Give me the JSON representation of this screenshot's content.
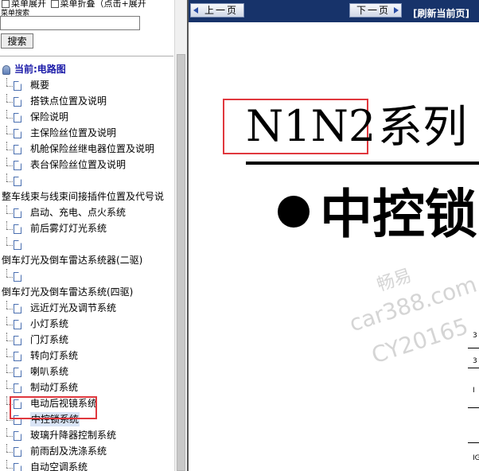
{
  "left_panel": {
    "top_options": [
      "菜单展开",
      "菜单折叠（点击+展开"
    ],
    "search_caption": "菜单搜索",
    "search_value": "",
    "search_button": "搜索",
    "root_label": "当前:电路图",
    "items": [
      "概要",
      "搭铁点位置及说明",
      "保险说明",
      "主保险丝位置及说明",
      "机舱保险丝继电器位置及说明",
      "表台保险丝位置及说明",
      "",
      "整车线束与线束间接插件位置及代号说",
      "启动、充电、点火系统",
      "前后雾灯灯光系统",
      "",
      "倒车灯光及倒车雷达系统器(二驱)",
      "",
      "倒车灯光及倒车雷达系统(四驱)",
      "远近灯光及调节系统",
      "小灯系统",
      "门灯系统",
      "转向灯系统",
      "喇叭系统",
      "制动灯系统",
      "电动后视镜系统",
      "中控锁系统",
      "玻璃升降器控制系统",
      "前雨刮及洗涤系统",
      "自动空调系统"
    ],
    "selected_item": "中控锁系统"
  },
  "toolbar": {
    "prev_label": "上一页",
    "next_label": "下一页",
    "refresh_label": "[刷新当前页]"
  },
  "document": {
    "model": "N1N2",
    "series_text": "系列",
    "subtitle": "中控锁",
    "watermark": [
      "畅易",
      "car388.com",
      "CY20165"
    ],
    "table_fragments": [
      "3",
      "3",
      "I",
      "IG"
    ]
  },
  "colors": {
    "toolbar_bg": "#17336a",
    "root_label": "#1a1aa8",
    "annotation_red": "#e0383e",
    "watermark": "#d5d5d5"
  }
}
